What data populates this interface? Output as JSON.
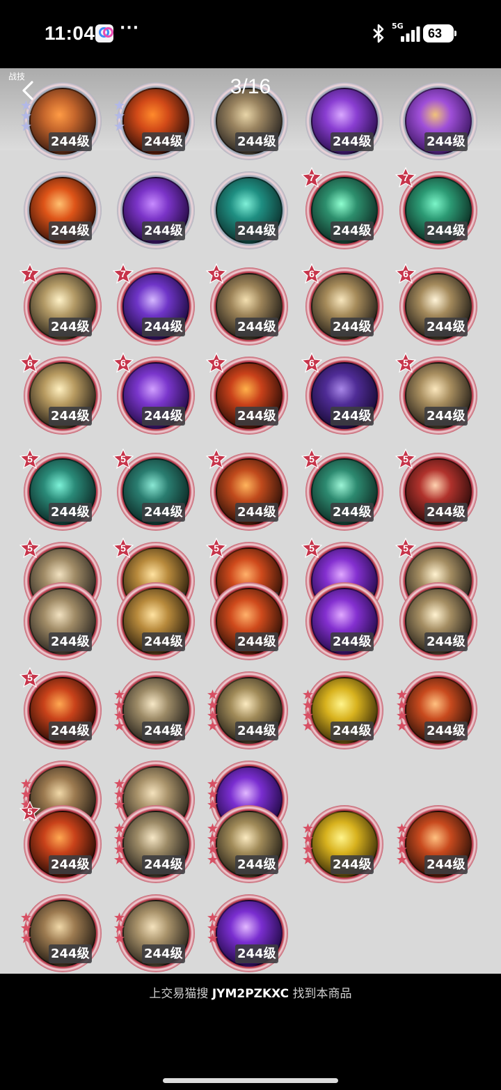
{
  "status_bar": {
    "time": "11:04",
    "dots": "···",
    "network": "5G",
    "battery": "63",
    "icons": [
      "app-badge-icon",
      "bluetooth-icon",
      "signal-icon",
      "battery-icon"
    ]
  },
  "viewer": {
    "section_label": "战技",
    "page_indicator": "3/16",
    "back_icon": "chevron-left-icon"
  },
  "skills": [
    {
      "level": "244级",
      "stars": 3,
      "star_color": "silver",
      "colors": [
        "#c5662c",
        "#3b1a10",
        "#ff9b45"
      ],
      "ring": "#9aa6b5"
    },
    {
      "level": "244级",
      "stars": 3,
      "star_color": "silver",
      "colors": [
        "#d24a18",
        "#2e0e08",
        "#ff8a2c"
      ],
      "ring": "#9aa6b5"
    },
    {
      "level": "244级",
      "stars": 0,
      "colors": [
        "#9a8460",
        "#272320",
        "#e8d5a8"
      ],
      "ring": "#9aa6b5"
    },
    {
      "level": "244级",
      "stars": 0,
      "colors": [
        "#8a3ed2",
        "#2a0e4e",
        "#d9a8ff"
      ],
      "ring": "#9aa6b5"
    },
    {
      "level": "244级",
      "stars": 0,
      "colors": [
        "#9f4fd8",
        "#3a1560",
        "#f0c27a"
      ],
      "ring": "#9aa6b5"
    },
    {
      "level": "244级",
      "stars": 0,
      "colors": [
        "#de5418",
        "#3a1208",
        "#ffc070"
      ],
      "ring": "#9aa6b5"
    },
    {
      "level": "244级",
      "stars": 0,
      "colors": [
        "#7b34c8",
        "#22093f",
        "#c78bff"
      ],
      "ring": "#9aa6b5"
    },
    {
      "level": "244级",
      "stars": 0,
      "colors": [
        "#1f8f82",
        "#0c2f2c",
        "#7ff0d8"
      ],
      "ring": "#9aa6b5"
    },
    {
      "level": "244级",
      "badge": "7",
      "colors": [
        "#2d8f6d",
        "#0d2a22",
        "#8fffd0"
      ],
      "ring": "#b8394a"
    },
    {
      "level": "244级",
      "badge": "7",
      "colors": [
        "#2c9a74",
        "#0b2a20",
        "#7bf5c8"
      ],
      "ring": "#b8394a"
    },
    {
      "level": "244级",
      "badge": "7",
      "colors": [
        "#b39a66",
        "#2a241a",
        "#fff2c8"
      ],
      "ring": "#b8394a"
    },
    {
      "level": "244级",
      "badge": "7",
      "colors": [
        "#6f35c8",
        "#1c0a3c",
        "#d5b8ff"
      ],
      "ring": "#b8394a"
    },
    {
      "level": "244级",
      "badge": "6",
      "colors": [
        "#9c8358",
        "#1f1b16",
        "#f3dfb0"
      ],
      "ring": "#b8394a"
    },
    {
      "level": "244级",
      "badge": "6",
      "colors": [
        "#a68b5a",
        "#231e18",
        "#f7e6bd"
      ],
      "ring": "#b8394a"
    },
    {
      "level": "244级",
      "badge": "6",
      "colors": [
        "#a48a5c",
        "#1e1a15",
        "#fff4d8"
      ],
      "ring": "#b8394a"
    },
    {
      "level": "244级",
      "badge": "6",
      "colors": [
        "#b79a60",
        "#272018",
        "#fff0c0"
      ],
      "ring": "#b8394a"
    },
    {
      "level": "244级",
      "badge": "6",
      "colors": [
        "#7a36cc",
        "#230b45",
        "#d1a0ff"
      ],
      "ring": "#b8394a"
    },
    {
      "level": "244级",
      "badge": "6",
      "colors": [
        "#c9411a",
        "#2a0c06",
        "#ffb14a"
      ],
      "ring": "#b8394a"
    },
    {
      "level": "244级",
      "badge": "6",
      "colors": [
        "#4f2c96",
        "#180a33",
        "#a887e8"
      ],
      "ring": "#b8394a"
    },
    {
      "level": "244级",
      "badge": "5",
      "colors": [
        "#a88e5f",
        "#221c16",
        "#fbe7bd"
      ],
      "ring": "#b8394a"
    },
    {
      "level": "244级",
      "badge": "5",
      "colors": [
        "#2a8a78",
        "#0c2724",
        "#7df2d8"
      ],
      "ring": "#b8394a"
    },
    {
      "level": "244级",
      "badge": "5",
      "colors": [
        "#2a7d70",
        "#0b2622",
        "#8ae8d4"
      ],
      "ring": "#b8394a"
    },
    {
      "level": "244级",
      "badge": "5",
      "colors": [
        "#c04a1c",
        "#2a0f08",
        "#ffb45c"
      ],
      "ring": "#b8394a"
    },
    {
      "level": "244级",
      "badge": "5",
      "colors": [
        "#2d8a70",
        "#0d2a22",
        "#9cf5d6"
      ],
      "ring": "#b8394a"
    },
    {
      "level": "244级",
      "badge": "5",
      "colors": [
        "#b0322c",
        "#2c0b0a",
        "#ffd2b0"
      ],
      "ring": "#b8394a"
    },
    {
      "level": "244级",
      "badge": "5",
      "colors": [
        "#a08b66",
        "#2a2520",
        "#f1e1c0"
      ],
      "ring": "#b8394a"
    },
    {
      "level": "244级",
      "badge": "5",
      "colors": [
        "#b88a3c",
        "#2a1d0c",
        "#ffe2a0"
      ],
      "ring": "#b8394a"
    },
    {
      "level": "244级",
      "badge": "5",
      "colors": [
        "#cf4a1c",
        "#2c0f06",
        "#ffb06a"
      ],
      "ring": "#b8394a"
    },
    {
      "level": "244级",
      "badge": "5",
      "colors": [
        "#8430d0",
        "#240a48",
        "#e0a8ff"
      ],
      "ring": "#b8394a"
    },
    {
      "level": "244级",
      "badge": "5",
      "colors": [
        "#a48d62",
        "#252019",
        "#fff2d0"
      ],
      "ring": "#b8394a"
    },
    {
      "level": "244级",
      "stars": 0,
      "colors": [
        "#a08b66",
        "#2a2520",
        "#f1e1c0"
      ],
      "ring": "#b8394a"
    },
    {
      "level": "244级",
      "stars": 0,
      "colors": [
        "#b88a3c",
        "#2a1d0c",
        "#ffe2a0"
      ],
      "ring": "#b8394a"
    },
    {
      "level": "244级",
      "stars": 0,
      "colors": [
        "#cf4a1c",
        "#2c0f06",
        "#ffb06a"
      ],
      "ring": "#b8394a"
    },
    {
      "level": "244级",
      "stars": 0,
      "colors": [
        "#8430d0",
        "#240a48",
        "#e0a8ff"
      ],
      "ring": "#b8394a"
    },
    {
      "level": "244级",
      "stars": 0,
      "colors": [
        "#a48d62",
        "#252019",
        "#fff2d0"
      ],
      "ring": "#b8394a"
    },
    {
      "level": "244级",
      "badge": "5",
      "colors": [
        "#c9421a",
        "#2a0c06",
        "#ffa852"
      ],
      "ring": "#b8394a"
    },
    {
      "level": "244级",
      "stars": 4,
      "star_color": "red",
      "colors": [
        "#9c8a66",
        "#221e19",
        "#f6e7c6"
      ],
      "ring": "#b8394a"
    },
    {
      "level": "244级",
      "stars": 4,
      "star_color": "red",
      "colors": [
        "#a08a58",
        "#221d16",
        "#fbeac0"
      ],
      "ring": "#b8394a"
    },
    {
      "level": "244级",
      "stars": 4,
      "star_color": "red",
      "colors": [
        "#d8b21e",
        "#3a2c08",
        "#fff48a"
      ],
      "ring": "#b8394a"
    },
    {
      "level": "244级",
      "stars": 4,
      "star_color": "red",
      "colors": [
        "#c84a1e",
        "#2c1008",
        "#ffc080"
      ],
      "ring": "#b8394a"
    },
    {
      "level": "",
      "stars": 3,
      "star_color": "red",
      "colors": [
        "#9c7a50",
        "#241c14",
        "#f0d8a8"
      ],
      "ring": "#b8394a"
    },
    {
      "level": "",
      "stars": 3,
      "star_color": "red",
      "colors": [
        "#a8926a",
        "#2a241b",
        "#f4e2bd"
      ],
      "ring": "#b8394a"
    },
    {
      "level": "",
      "stars": 3,
      "star_color": "red",
      "colors": [
        "#7a2ed0",
        "#1f0942",
        "#e2b8ff"
      ],
      "ring": "#b8394a"
    },
    {
      "level": "244级",
      "badge": "5",
      "colors": [
        "#c9421a",
        "#2a0c06",
        "#ffa852"
      ],
      "ring": "#b8394a"
    },
    {
      "level": "244级",
      "stars": 4,
      "star_color": "red",
      "colors": [
        "#9c8a66",
        "#221e19",
        "#f6e7c6"
      ],
      "ring": "#b8394a"
    },
    {
      "level": "244级",
      "stars": 4,
      "star_color": "red",
      "colors": [
        "#a08a58",
        "#221d16",
        "#fbeac0"
      ],
      "ring": "#b8394a"
    },
    {
      "level": "244级",
      "stars": 4,
      "star_color": "red",
      "colors": [
        "#d8b21e",
        "#3a2c08",
        "#fff48a"
      ],
      "ring": "#b8394a"
    },
    {
      "level": "244级",
      "stars": 4,
      "star_color": "red",
      "colors": [
        "#c84a1e",
        "#2c1008",
        "#ffc080"
      ],
      "ring": "#b8394a"
    },
    {
      "level": "244级",
      "stars": 3,
      "star_color": "red",
      "colors": [
        "#9c7a50",
        "#241c14",
        "#f0d8a8"
      ],
      "ring": "#b8394a"
    },
    {
      "level": "244级",
      "stars": 3,
      "star_color": "red",
      "colors": [
        "#a8926a",
        "#2a241b",
        "#f4e2bd"
      ],
      "ring": "#b8394a"
    },
    {
      "level": "244级",
      "stars": 3,
      "star_color": "red",
      "colors": [
        "#7a2ed0",
        "#1f0942",
        "#e2b8ff"
      ],
      "ring": "#b8394a"
    }
  ],
  "footer": {
    "prefix": "上交易猫搜",
    "code": "JYM2PZKXC",
    "suffix": "找到本商品"
  }
}
